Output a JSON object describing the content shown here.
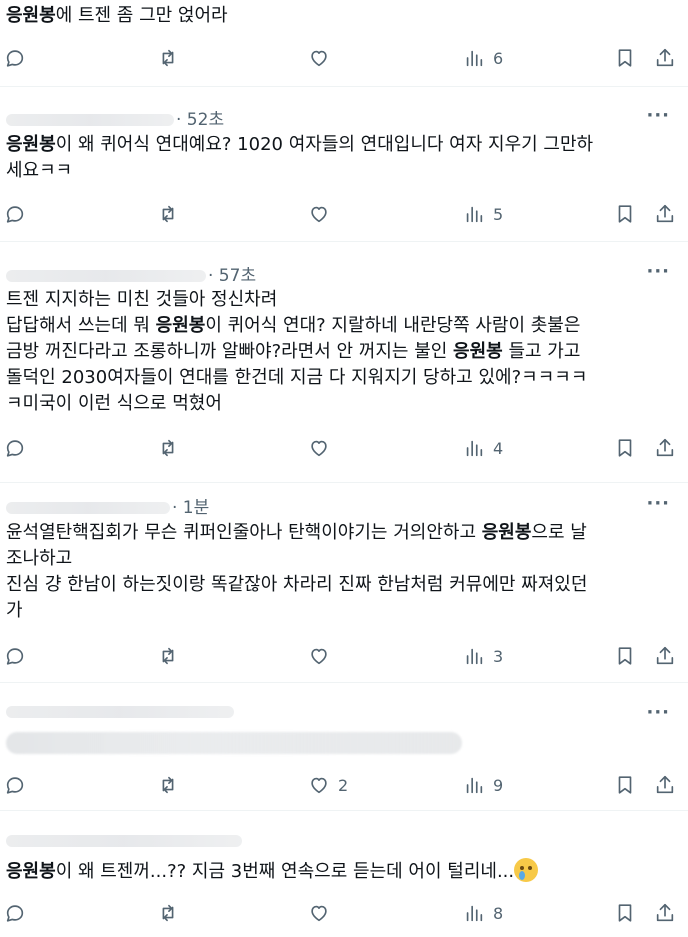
{
  "posts": [
    {
      "author": "",
      "time": "",
      "segments": [
        {
          "t": "응원봉",
          "b": true
        },
        {
          "t": "에 트젠 좀 그만 얹어라",
          "b": false
        }
      ],
      "metrics": {
        "replies": "",
        "reposts": "",
        "likes": "",
        "views": "6"
      }
    },
    {
      "author": "",
      "time": "· 52초",
      "segments": [
        {
          "t": "응원봉",
          "b": true
        },
        {
          "t": "이 왜 퀴어식 연대예요? 1020 여자들의 연대입니다 여자 지우기 그만하\n세요ㅋㅋ",
          "b": false
        }
      ],
      "metrics": {
        "replies": "",
        "reposts": "",
        "likes": "",
        "views": "5"
      }
    },
    {
      "author": "",
      "time": "· 57초",
      "segments": [
        {
          "t": "트젠 지지하는 미친 것들아 정신차려\n답답해서 쓰는데 뭐 ",
          "b": false
        },
        {
          "t": "응원봉",
          "b": true
        },
        {
          "t": "이 퀴어식 연대? 지랄하네 내란당쪽 사람이 촛불은\n금방 꺼진다라고 조롱하니까 알빠야?라면서 안 꺼지는 불인 ",
          "b": false
        },
        {
          "t": "응원봉",
          "b": true
        },
        {
          "t": " 들고 가고\n돌덕인 2030여자들이 연대를 한건데 지금 다 지워지기 당하고 있에?ㅋㅋㅋㅋ\nㅋ미국이 이런 식으로 먹혔어",
          "b": false
        }
      ],
      "metrics": {
        "replies": "",
        "reposts": "",
        "likes": "",
        "views": "4"
      }
    },
    {
      "author": "",
      "time": "· 1분",
      "segments": [
        {
          "t": "윤석열탄핵집회가 무슨 퀴퍼인줄아나 탄핵이야기는 거의안하고 ",
          "b": false
        },
        {
          "t": "응원봉",
          "b": true
        },
        {
          "t": "으로 날\n조나하고\n진심 걍 한남이 하는짓이랑 똑같잖아 차라리 진짜 한남처럼 커뮤에만 짜져있던\n가",
          "b": false
        }
      ],
      "metrics": {
        "replies": "",
        "reposts": "",
        "likes": "",
        "views": "3"
      }
    },
    {
      "author": "",
      "time": "",
      "segments": [],
      "metrics": {
        "replies": "",
        "reposts": "",
        "likes": "2",
        "views": "9"
      }
    },
    {
      "author": "",
      "time": "",
      "segments": [
        {
          "t": "응원봉",
          "b": true
        },
        {
          "t": "이 왜 트젠꺼...?? 지금 3번째 연속으로 듣는데 어이 털리네...",
          "b": false
        }
      ],
      "emoji": "face-holding-back-tears",
      "metrics": {
        "replies": "",
        "reposts": "",
        "likes": "",
        "views": "8"
      }
    }
  ],
  "icons": {
    "reply": "reply-icon",
    "repost": "repost-icon",
    "like": "heart-icon",
    "views": "views-icon",
    "bookmark": "bookmark-icon",
    "share": "share-icon",
    "more": "more-icon"
  },
  "more_label": "···",
  "colors": {
    "text": "#0f1419",
    "secondary": "#536471",
    "divider": "#eff3f4"
  }
}
